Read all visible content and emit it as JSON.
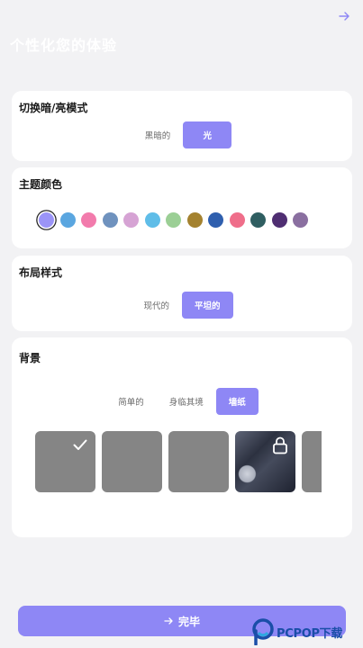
{
  "header": {
    "title": "个性化您的体验",
    "nav_icon": "arrow-right-icon"
  },
  "theme_mode": {
    "title": "切换暗/亮模式",
    "options": [
      "黑暗的",
      "光"
    ],
    "selected": "光"
  },
  "theme_color": {
    "title": "主题颜色",
    "swatches": [
      "#9b94f7",
      "#5aa6e0",
      "#f27bac",
      "#6f92be",
      "#d6a3d4",
      "#5fbde8",
      "#9bcf95",
      "#a4822f",
      "#2f5fae",
      "#ef6e8a",
      "#2f5e61",
      "#4f2e72",
      "#8a6fa0"
    ],
    "selected_index": 0
  },
  "layout_style": {
    "title": "布局样式",
    "options": [
      "现代的",
      "平坦的"
    ],
    "selected": "平坦的"
  },
  "background": {
    "title": "背景",
    "options": [
      "简单的",
      "身临其境",
      "墙纸"
    ],
    "selected": "墙纸",
    "thumbnails": [
      {
        "kind": "plain",
        "state": "selected",
        "icon": "checkmark-icon"
      },
      {
        "kind": "plain",
        "state": "normal"
      },
      {
        "kind": "plain",
        "state": "normal"
      },
      {
        "kind": "wallpaper",
        "state": "locked",
        "icon": "lock-icon"
      },
      {
        "kind": "plain",
        "state": "normal"
      }
    ]
  },
  "footer": {
    "done_label": "完毕",
    "done_icon": "arrow-right-icon"
  },
  "watermark": {
    "text": "PCPOP下载"
  },
  "colors": {
    "accent": "#8e87f5",
    "page_bg": "#f2f2f4",
    "card_bg": "#ffffff",
    "thumb_gray": "#858585"
  }
}
